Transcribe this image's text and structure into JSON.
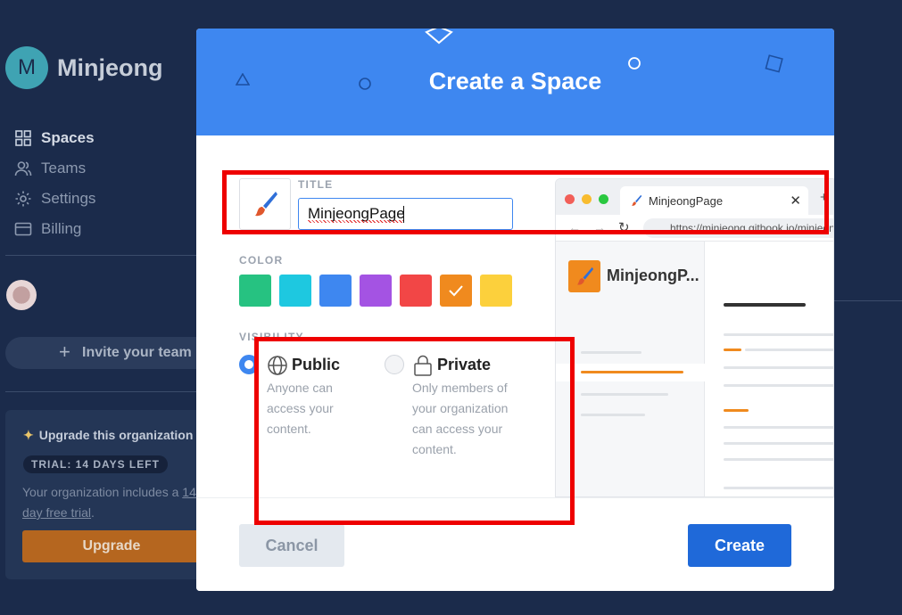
{
  "sidebar": {
    "avatar_initial": "M",
    "org_name": "Minjeong",
    "nav": [
      {
        "label": "Spaces",
        "icon": "grid-icon"
      },
      {
        "label": "Teams",
        "icon": "users-icon"
      },
      {
        "label": "Settings",
        "icon": "gear-icon"
      },
      {
        "label": "Billing",
        "icon": "credit-card-icon"
      }
    ],
    "invite_label": "Invite your team",
    "upgrade": {
      "title": "Upgrade this organization",
      "badge": "TRIAL: 14 DAYS LEFT",
      "text_before": "Your organization includes a ",
      "text_link": "14 day free trial",
      "text_after": ".",
      "button": "Upgrade"
    }
  },
  "modal": {
    "title": "Create a Space",
    "title_label": "TITLE",
    "title_value": "MinjeongPage",
    "color_label": "COLOR",
    "colors": [
      "#26c281",
      "#1ec8e0",
      "#3e87f0",
      "#a453e3",
      "#f24646",
      "#f08a1e",
      "#fcd03c"
    ],
    "selected_color": "#f08a1e",
    "visibility_label": "VISIBILITY",
    "visibility": [
      {
        "title": "Public",
        "description": "Anyone can access your content.",
        "icon": "globe-icon",
        "selected": true
      },
      {
        "title": "Private",
        "description": "Only members of your organization can access your content.",
        "icon": "lock-icon",
        "selected": false
      }
    ],
    "preview": {
      "tab_title": "MinjeongPage",
      "url": "https://minjeong.gitbook.io/minjeong",
      "space_name": "MinjeongP..."
    },
    "cancel": "Cancel",
    "create": "Create"
  }
}
